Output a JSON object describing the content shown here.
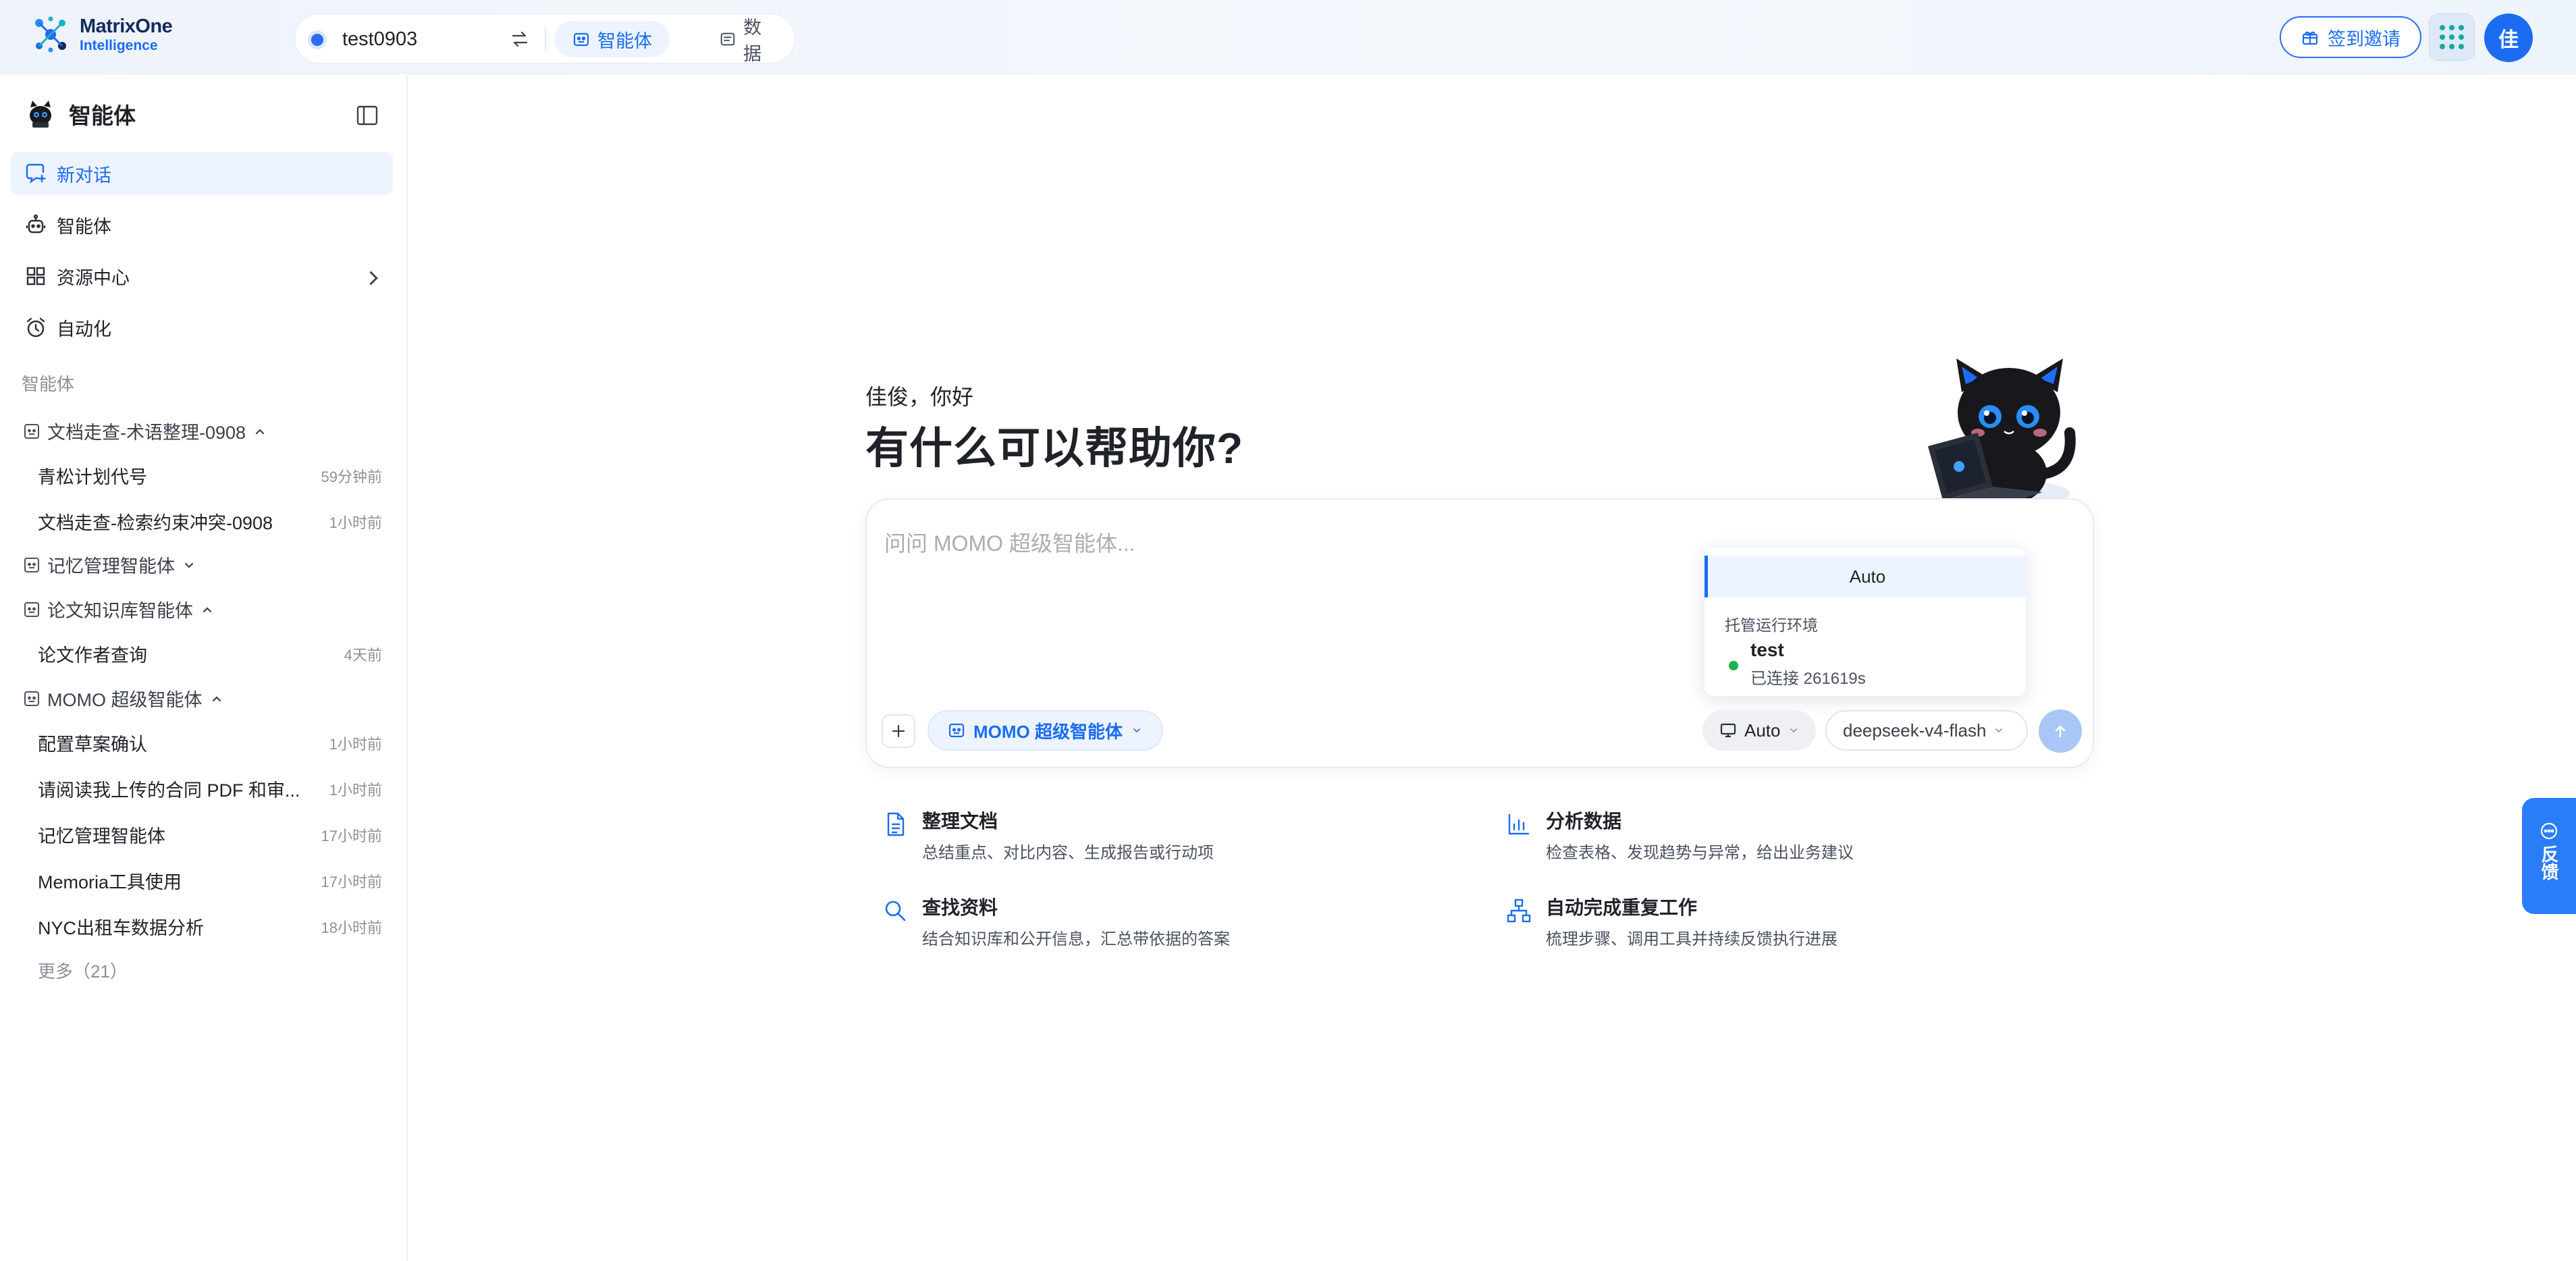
{
  "brand": {
    "line1": "MatrixOne",
    "line2": "Intelligence"
  },
  "workspace": {
    "name": "test0903",
    "tabs": [
      {
        "label": "智能体",
        "active": true
      },
      {
        "label": "数据",
        "active": false
      }
    ]
  },
  "topbar": {
    "invite_label": "签到邀请",
    "avatar_text": "佳"
  },
  "sidebar": {
    "title": "智能体",
    "nav": [
      {
        "label": "新对话",
        "active": true
      },
      {
        "label": "智能体"
      },
      {
        "label": "资源中心"
      },
      {
        "label": "自动化"
      }
    ],
    "section_label": "智能体",
    "groups": [
      {
        "name": "文档走查-术语整理-0908",
        "expanded": true,
        "items": [
          {
            "title": "青松计划代号",
            "time": "59分钟前"
          },
          {
            "title": "文档走查-检索约束冲突-0908",
            "time": "1小时前"
          }
        ]
      },
      {
        "name": "记忆管理智能体",
        "expanded": false,
        "items": []
      },
      {
        "name": "论文知识库智能体",
        "expanded": true,
        "items": [
          {
            "title": "论文作者查询",
            "time": "4天前"
          }
        ]
      },
      {
        "name": "MOMO 超级智能体",
        "expanded": true,
        "items": [
          {
            "title": "配置草案确认",
            "time": "1小时前"
          },
          {
            "title": "请阅读我上传的合同 PDF 和审...",
            "time": "1小时前"
          },
          {
            "title": "记忆管理智能体",
            "time": "17小时前"
          },
          {
            "title": "Memoria工具使用",
            "time": "17小时前"
          },
          {
            "title": "NYC出租车数据分析",
            "time": "18小时前"
          }
        ]
      }
    ],
    "more_label": "更多（21）"
  },
  "main": {
    "greeting": "佳俊，你好",
    "headline": "有什么可以帮助你?",
    "composer": {
      "placeholder": "问问 MOMO 超级智能体...",
      "agent_chip": "MOMO 超级智能体",
      "env_chip": "Auto",
      "model_chip": "deepseek-v4-flash"
    },
    "env_dropdown": {
      "auto_option": "Auto",
      "section_label": "托管运行环境",
      "env_name": "test",
      "env_status": "已连接 261619s"
    },
    "suggestions": [
      {
        "title": "整理文档",
        "desc": "总结重点、对比内容、生成报告或行动项",
        "icon": "document-icon"
      },
      {
        "title": "分析数据",
        "desc": "检查表格、发现趋势与异常，给出业务建议",
        "icon": "bar-chart-icon"
      },
      {
        "title": "查找资料",
        "desc": "结合知识库和公开信息，汇总带依据的答案",
        "icon": "search-icon"
      },
      {
        "title": "自动完成重复工作",
        "desc": "梳理步骤、调用工具并持续反馈执行进展",
        "icon": "workflow-icon"
      }
    ]
  },
  "feedback": {
    "label": "反馈"
  },
  "colors": {
    "accent": "#1b6cf0",
    "online": "#22b24c",
    "feedback_bg": "#2a7df6"
  }
}
